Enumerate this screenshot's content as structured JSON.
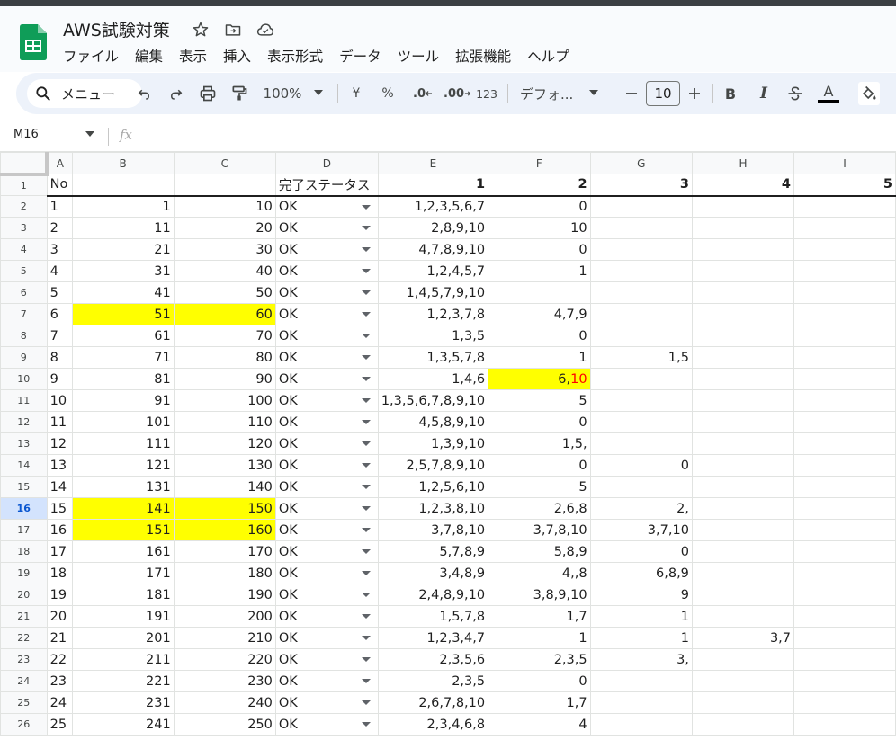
{
  "app": {
    "doc_title": "AWS試験対策",
    "icons": {
      "logo": "google-sheets-logo",
      "star": "star-icon",
      "move": "move-to-folder-icon",
      "cloud": "cloud-status-icon"
    },
    "colors": {
      "brand": "#0f9d58",
      "highlight": "#ffff00",
      "accent": "#0b57d0"
    }
  },
  "menu": [
    "ファイル",
    "編集",
    "表示",
    "挿入",
    "表示形式",
    "データ",
    "ツール",
    "拡張機能",
    "ヘルプ"
  ],
  "toolbar": {
    "search_label": "メニュー",
    "zoom": "100%",
    "currency": "¥",
    "percent": "%",
    "dec_decrease": ".0",
    "dec_increase": ".00",
    "number_format": "123",
    "font_family": "デフォ...",
    "font_size": "10",
    "bold": "B",
    "italic": "I",
    "text_color_glyph": "A"
  },
  "formula_bar": {
    "cell_ref": "M16",
    "fx": "fx"
  },
  "grid": {
    "columns": [
      "A",
      "B",
      "C",
      "D",
      "E",
      "F",
      "G",
      "H",
      "I"
    ],
    "header_row": {
      "a": "No",
      "b": "",
      "c": "",
      "d": "完了ステータス",
      "e": "1",
      "f": "2",
      "g": "3",
      "h": "4",
      "i": "5"
    },
    "selected_row": 16,
    "rows": [
      {
        "n": 2,
        "a": "1",
        "b": "1",
        "c": "10",
        "d": "OK",
        "e": "1,2,3,5,6,7",
        "f": "0",
        "g": "",
        "h": ""
      },
      {
        "n": 3,
        "a": "2",
        "b": "11",
        "c": "20",
        "d": "OK",
        "e": "2,8,9,10",
        "f": "10",
        "g": "",
        "h": ""
      },
      {
        "n": 4,
        "a": "3",
        "b": "21",
        "c": "30",
        "d": "OK",
        "e": "4,7,8,9,10",
        "f": "0",
        "g": "",
        "h": ""
      },
      {
        "n": 5,
        "a": "4",
        "b": "31",
        "c": "40",
        "d": "OK",
        "e": "1,2,4,5,7",
        "f": "1",
        "g": "",
        "h": ""
      },
      {
        "n": 6,
        "a": "5",
        "b": "41",
        "c": "50",
        "d": "OK",
        "e": "1,4,5,7,9,10",
        "f": "",
        "g": "",
        "h": ""
      },
      {
        "n": 7,
        "a": "6",
        "b": "51",
        "c": "60",
        "d": "OK",
        "e": "1,2,3,7,8",
        "f": "4,7,9",
        "g": "",
        "h": "",
        "hl_bc": true
      },
      {
        "n": 8,
        "a": "7",
        "b": "61",
        "c": "70",
        "d": "OK",
        "e": "1,3,5",
        "f": "0",
        "g": "",
        "h": ""
      },
      {
        "n": 9,
        "a": "8",
        "b": "71",
        "c": "80",
        "d": "OK",
        "e": "1,3,5,7,8",
        "f": "1",
        "g": "1,5",
        "h": ""
      },
      {
        "n": 10,
        "a": "9",
        "b": "81",
        "c": "90",
        "d": "OK",
        "e": "1,4,6",
        "f": "6,",
        "f_red": "10",
        "g": "",
        "h": "",
        "hl_f": true
      },
      {
        "n": 11,
        "a": "10",
        "b": "91",
        "c": "100",
        "d": "OK",
        "e": "1,3,5,6,7,8,9,10",
        "f": "5",
        "g": "",
        "h": ""
      },
      {
        "n": 12,
        "a": "11",
        "b": "101",
        "c": "110",
        "d": "OK",
        "e": "4,5,8,9,10",
        "f": "0",
        "g": "",
        "h": ""
      },
      {
        "n": 13,
        "a": "12",
        "b": "111",
        "c": "120",
        "d": "OK",
        "e": "1,3,9,10",
        "f": "1,5,",
        "g": "",
        "h": ""
      },
      {
        "n": 14,
        "a": "13",
        "b": "121",
        "c": "130",
        "d": "OK",
        "e": "2,5,7,8,9,10",
        "f": "0",
        "g": "0",
        "h": ""
      },
      {
        "n": 15,
        "a": "14",
        "b": "131",
        "c": "140",
        "d": "OK",
        "e": "1,2,5,6,10",
        "f": "5",
        "g": "",
        "h": ""
      },
      {
        "n": 16,
        "a": "15",
        "b": "141",
        "c": "150",
        "d": "OK",
        "e": "1,2,3,8,10",
        "f": "2,6,8",
        "g": "2,",
        "h": "",
        "hl_bc": true
      },
      {
        "n": 17,
        "a": "16",
        "b": "151",
        "c": "160",
        "d": "OK",
        "e": "3,7,8,10",
        "f": "3,7,8,10",
        "g": "3,7,10",
        "h": "",
        "hl_bc": true
      },
      {
        "n": 18,
        "a": "17",
        "b": "161",
        "c": "170",
        "d": "OK",
        "e": "5,7,8,9",
        "f": "5,8,9",
        "g": "0",
        "h": ""
      },
      {
        "n": 19,
        "a": "18",
        "b": "171",
        "c": "180",
        "d": "OK",
        "e": "3,4,8,9",
        "f": "4,,8",
        "g": "6,8,9",
        "h": ""
      },
      {
        "n": 20,
        "a": "19",
        "b": "181",
        "c": "190",
        "d": "OK",
        "e": "2,4,8,9,10",
        "f": "3,8,9,10",
        "g": "9",
        "h": ""
      },
      {
        "n": 21,
        "a": "20",
        "b": "191",
        "c": "200",
        "d": "OK",
        "e": "1,5,7,8",
        "f": "1,7",
        "g": "1",
        "h": ""
      },
      {
        "n": 22,
        "a": "21",
        "b": "201",
        "c": "210",
        "d": "OK",
        "e": "1,2,3,4,7",
        "f": "1",
        "g": "1",
        "h": "3,7"
      },
      {
        "n": 23,
        "a": "22",
        "b": "211",
        "c": "220",
        "d": "OK",
        "e": "2,3,5,6",
        "f": "2,3,5",
        "g": "3,",
        "h": ""
      },
      {
        "n": 24,
        "a": "23",
        "b": "221",
        "c": "230",
        "d": "OK",
        "e": "2,3,5",
        "f": "0",
        "g": "",
        "h": ""
      },
      {
        "n": 25,
        "a": "24",
        "b": "231",
        "c": "240",
        "d": "OK",
        "e": "2,6,7,8,10",
        "f": "1,7",
        "g": "",
        "h": ""
      },
      {
        "n": 26,
        "a": "25",
        "b": "241",
        "c": "250",
        "d": "OK",
        "e": "2,3,4,6,8",
        "f": "4",
        "g": "",
        "h": ""
      }
    ]
  }
}
